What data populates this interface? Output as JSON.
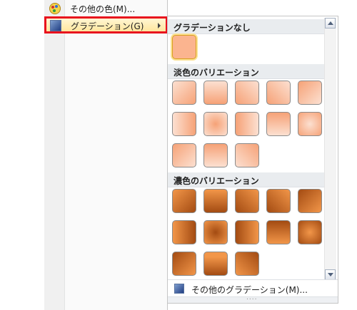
{
  "menu": {
    "items": [
      {
        "label": "その他の色(M)...",
        "icon": "color-palette-icon"
      },
      {
        "label": "グラデーション(G)",
        "icon": "gradient-icon",
        "has_submenu": true
      }
    ]
  },
  "submenu": {
    "none_header": "グラデーションなし",
    "light_header": "淡色のバリエーション",
    "dark_header": "濃色のバリエーション",
    "more_label": "その他のグラデーション(M)...",
    "grip": "....",
    "colors": {
      "none": "#fbb48f",
      "light_base": "#fbc2a5",
      "dark_base": "#e3762c",
      "selection": "#e8101d"
    }
  }
}
